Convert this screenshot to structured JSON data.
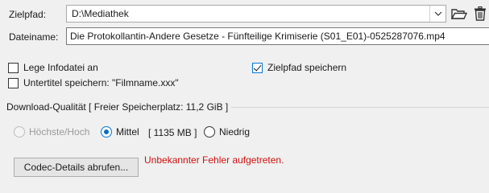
{
  "path": {
    "label": "Zielpfad:",
    "value": "D:\\Mediathek"
  },
  "filename": {
    "label": "Dateiname:",
    "value": "Die Protokollantin-Andere Gesetze - Fünfteilige Krimiserie (S01_E01)-0525287076.mp4"
  },
  "options": {
    "infofile_label": "Lege Infodatei an",
    "infofile_checked": false,
    "save_path_label": "Zielpfad speichern",
    "save_path_checked": true,
    "subtitle_label": "Untertitel speichern: \"Filmname.xxx\"",
    "subtitle_checked": false
  },
  "quality": {
    "group_label": "Download-Qualität [ Freier Speicherplatz: 11,2 GiB ]",
    "high_label": "Höchste/Hoch",
    "mid_label": "Mittel",
    "mid_size": "[ 1135 MB ]",
    "low_label": "Niedrig",
    "selected": "mid"
  },
  "codec": {
    "button_label": "Codec-Details abrufen...",
    "error_text": "Unbekannter Fehler aufgetreten."
  },
  "icons": {
    "dropdown": "chevron-down-icon",
    "folder": "folder-open-icon",
    "trash": "trash-icon"
  },
  "colors": {
    "accent": "#0078d7",
    "error": "#d01010"
  }
}
